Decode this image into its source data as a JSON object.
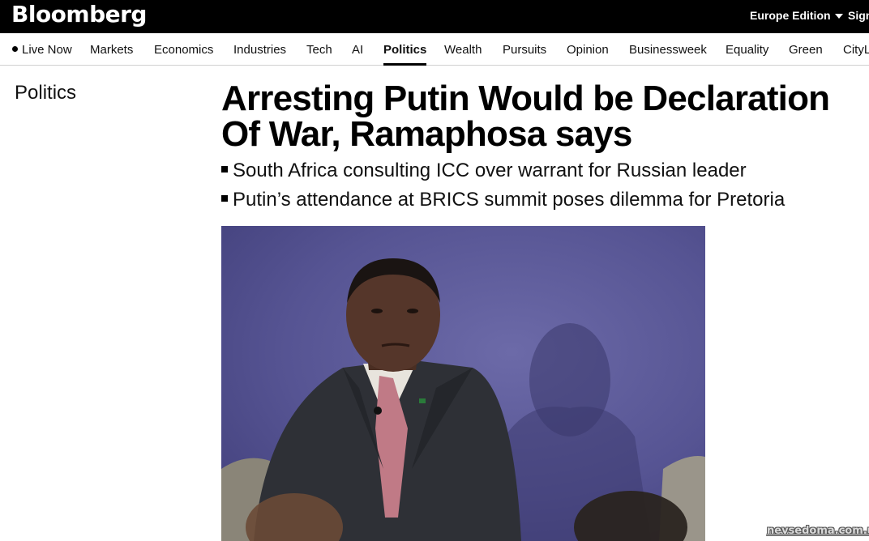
{
  "header": {
    "logo_text": "Bloomberg",
    "edition_label": "Europe Edition",
    "signin_label": "Sign"
  },
  "nav": {
    "items": [
      {
        "label": "Live Now"
      },
      {
        "label": "Markets"
      },
      {
        "label": "Economics"
      },
      {
        "label": "Industries"
      },
      {
        "label": "Tech"
      },
      {
        "label": "AI"
      },
      {
        "label": "Politics",
        "active": true
      },
      {
        "label": "Wealth"
      },
      {
        "label": "Pursuits"
      },
      {
        "label": "Opinion"
      },
      {
        "label": "Businessweek"
      },
      {
        "label": "Equality"
      },
      {
        "label": "Green"
      },
      {
        "label": "CityL"
      }
    ]
  },
  "article": {
    "section": "Politics",
    "headline": "Arresting Putin Would be Declaration Of War, Ramaphosa says",
    "bullets": [
      "South Africa consulting ICC over warrant for Russian leader",
      "Putin’s attendance at BRICS summit poses dilemma for Pretoria"
    ]
  },
  "watermark": "nevsedoma.com.ua",
  "colors": {
    "topbar": "#000000",
    "nav_border": "#d0d0d0",
    "photo_background": "#565493"
  }
}
